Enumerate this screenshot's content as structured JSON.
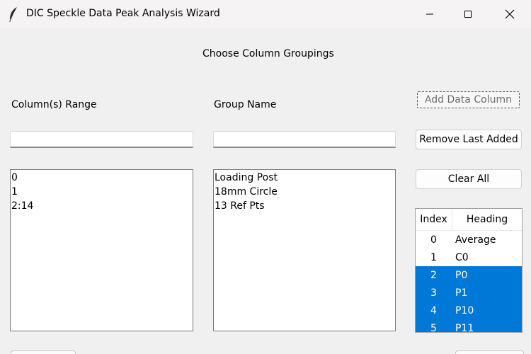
{
  "window": {
    "title": "DIC Speckle Data Peak Analysis Wizard",
    "icon": "feather-icon"
  },
  "main": {
    "heading": "Choose Column Groupings",
    "column_range_label": "Column(s) Range",
    "group_name_label": "Group Name",
    "column_range_input": "",
    "group_name_input": "",
    "column_ranges": [
      "0",
      "1",
      "2:14"
    ],
    "group_names": [
      "Loading Post",
      "18mm Circle",
      "13 Ref Pts"
    ]
  },
  "buttons": {
    "add_data_column": "Add Data Column",
    "remove_last_added": "Remove Last Added",
    "clear_all": "Clear All"
  },
  "table": {
    "headers": {
      "index": "Index",
      "heading": "Heading"
    },
    "rows": [
      {
        "index": "0",
        "heading": "Average",
        "selected": false
      },
      {
        "index": "1",
        "heading": "C0",
        "selected": false
      },
      {
        "index": "2",
        "heading": "P0",
        "selected": true
      },
      {
        "index": "3",
        "heading": "P1",
        "selected": true
      },
      {
        "index": "4",
        "heading": "P10",
        "selected": true
      },
      {
        "index": "5",
        "heading": "P11",
        "selected": true
      }
    ],
    "selection_color": "#0078d7"
  }
}
